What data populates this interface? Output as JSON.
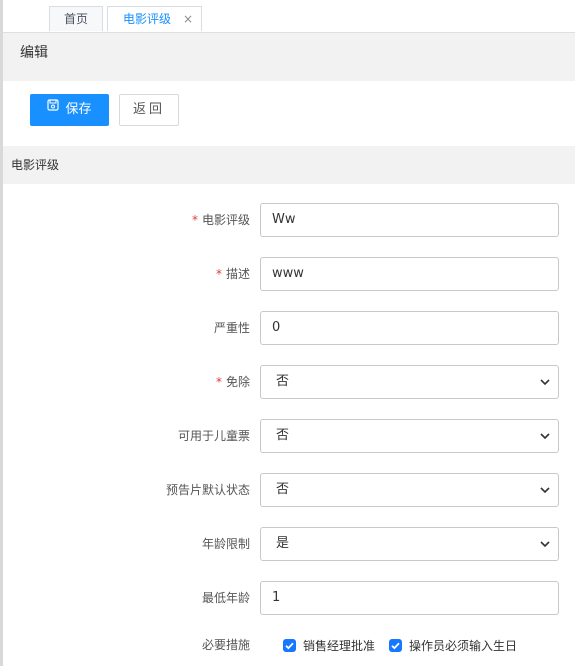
{
  "tabs": [
    {
      "label": "首页",
      "active": false
    },
    {
      "label": "电影评级",
      "active": true,
      "close": "×"
    }
  ],
  "edit_title": "编辑",
  "toolbar": {
    "save_label": "保存",
    "back_label": "返回"
  },
  "section_title": "电影评级",
  "form": {
    "rating": {
      "label": "电影评级",
      "required": true,
      "value": "Ww"
    },
    "description": {
      "label": "描述",
      "required": true,
      "value": "www"
    },
    "severity": {
      "label": "严重性",
      "required": false,
      "value": "0"
    },
    "exempt": {
      "label": "免除",
      "required": true,
      "value": "否"
    },
    "child_ticket": {
      "label": "可用于儿童票",
      "required": false,
      "value": "否"
    },
    "trailer_default": {
      "label": "预告片默认状态",
      "required": false,
      "value": "否"
    },
    "age_limit": {
      "label": "年龄限制",
      "required": false,
      "value": "是"
    },
    "min_age": {
      "label": "最低年龄",
      "required": false,
      "value": "1"
    },
    "required_measures": {
      "label": "必要措施",
      "options": [
        {
          "label": "销售经理批准",
          "checked": true
        },
        {
          "label": "操作员必须输入生日",
          "checked": true
        }
      ]
    }
  },
  "colors": {
    "primary": "#1890ff",
    "required": "#e4393c",
    "band": "#f2f2f2"
  },
  "icons": {
    "save": "floppy-disk-icon",
    "select": "chevron-down-icon",
    "check": "checkmark-icon"
  }
}
